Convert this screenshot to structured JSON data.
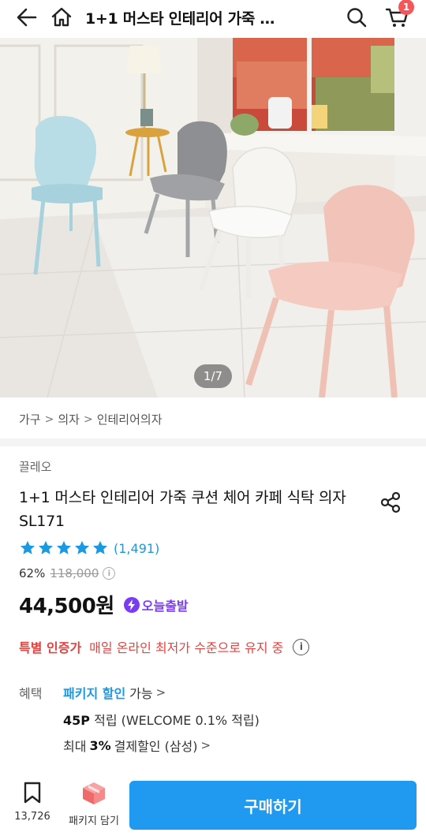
{
  "header": {
    "title": "1+1 머스타 인테리어 가죽 …",
    "cart_count": "1"
  },
  "gallery": {
    "counter": "1/7"
  },
  "breadcrumb": [
    "가구",
    "의자",
    "인테리어의자"
  ],
  "product": {
    "brand": "끌레오",
    "title": "1+1 머스타 인테리어 가죽 쿠션 체어 카페 식탁 의자 SL171",
    "rating": 5,
    "review_count": "(1,491)",
    "discount": "62%",
    "original_price": "118,000",
    "price": "44,500원",
    "delivery_badge": "오늘출발"
  },
  "special": {
    "label": "특별 인증가",
    "text": "매일 온라인 최저가 수준으로 유지 중"
  },
  "benefits": {
    "label": "혜택",
    "package_label": "패키지 할인",
    "package_suffix": "가능",
    "points_value": "45P",
    "points_text": "적립 (WELCOME 0.1% 적립)",
    "discount_prefix": "최대",
    "discount_value": "3%",
    "discount_text": "결제할인 (삼성)"
  },
  "bottom": {
    "wish_count": "13,726",
    "package_label": "패키지 담기",
    "buy_label": "구매하기"
  },
  "colors": {
    "accent_blue": "#1f9af0",
    "sale_red": "#e8423f",
    "fast_purple": "#7a3cf0"
  }
}
